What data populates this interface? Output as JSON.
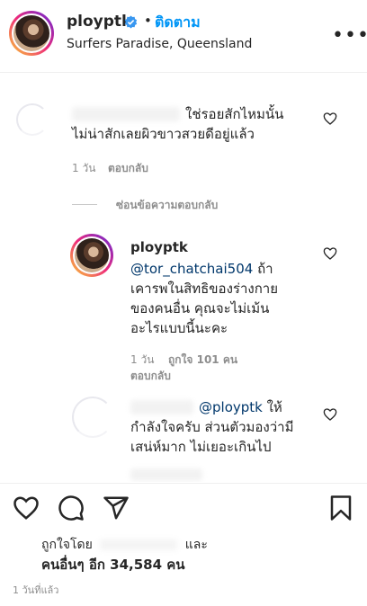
{
  "header": {
    "username": "ployptk",
    "separator": "•",
    "follow_label": "ติดตาม",
    "location": "Surfers Paradise, Queensland",
    "more_label": "•••"
  },
  "comments": [
    {
      "text_line1": "ใช่รอยสักไหมนั้น",
      "text_line2": "ไม่น่าสักเลยผิวขาวสวยดีอยู่แล้ว",
      "time": "1 วัน",
      "reply_label": "ตอบกลับ"
    }
  ],
  "hide_replies_label": "ซ่อนข้อความตอบกลับ",
  "reply": {
    "username": "ployptk",
    "mention": "@tor_chatchai504",
    "text_line1_rest": " ถ้า",
    "text_line2": "เคารพในสิทธิของร่างกาย",
    "text_line3": "ของคนอื่น คุณจะไม่เม้น",
    "text_line4": "อะไรแบบนี้นะคะ",
    "time": "1 วัน",
    "likes": "ถูกใจ 101 คน",
    "reply_label": "ตอบกลับ"
  },
  "reply2": {
    "mention": "@ployptk",
    "text_line1_rest": " ให้",
    "text_line2": "กำลังใจครับ ส่วนตัวมองว่ามี",
    "text_line3": "เสน่ห์มาก ไม่เยอะเกินไป"
  },
  "footer": {
    "liked_by_prefix": "ถูกใจโดย",
    "liked_by_and": "และ",
    "liked_count": "คนอื่นๆ อีก 34,584 คน",
    "time_ago": "1 วันที่แล้ว"
  },
  "icons": [
    "verified-icon",
    "heart-icon",
    "comment-icon",
    "share-icon",
    "bookmark-icon"
  ],
  "colors": {
    "link": "#0095f6",
    "mention": "#00376b",
    "meta": "#8e8e8e",
    "verified": "#3897f0"
  }
}
